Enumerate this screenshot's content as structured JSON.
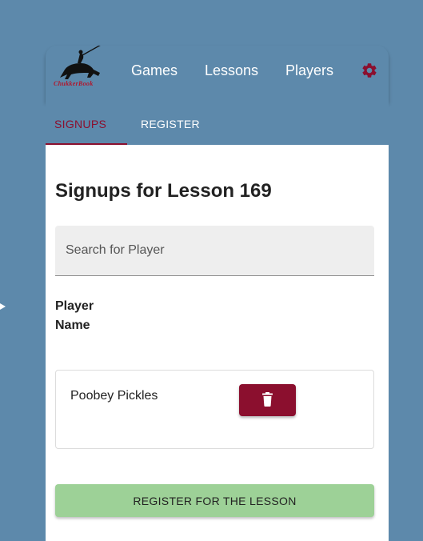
{
  "brand": {
    "logo_text": "ChukkerBook"
  },
  "nav": {
    "items": [
      {
        "label": "Games"
      },
      {
        "label": "Lessons"
      },
      {
        "label": "Players"
      }
    ],
    "settings_icon": "gear-icon"
  },
  "tabs": {
    "items": [
      {
        "label": "SIGNUPS",
        "active": true
      },
      {
        "label": "REGISTER",
        "active": false
      }
    ]
  },
  "page": {
    "title": "Signups for Lesson 169",
    "search_placeholder": "Search for Player",
    "search_value": "",
    "column_header": "Player Name",
    "rows": [
      {
        "player_name": "Poobey Pickles",
        "action_icon": "trash-icon"
      }
    ],
    "register_button": "REGISTER FOR THE LESSON"
  },
  "colors": {
    "background": "#5d89ab",
    "accent": "#8b0f2e",
    "register_button": "#9dd197",
    "logo_text": "#b0182e"
  }
}
